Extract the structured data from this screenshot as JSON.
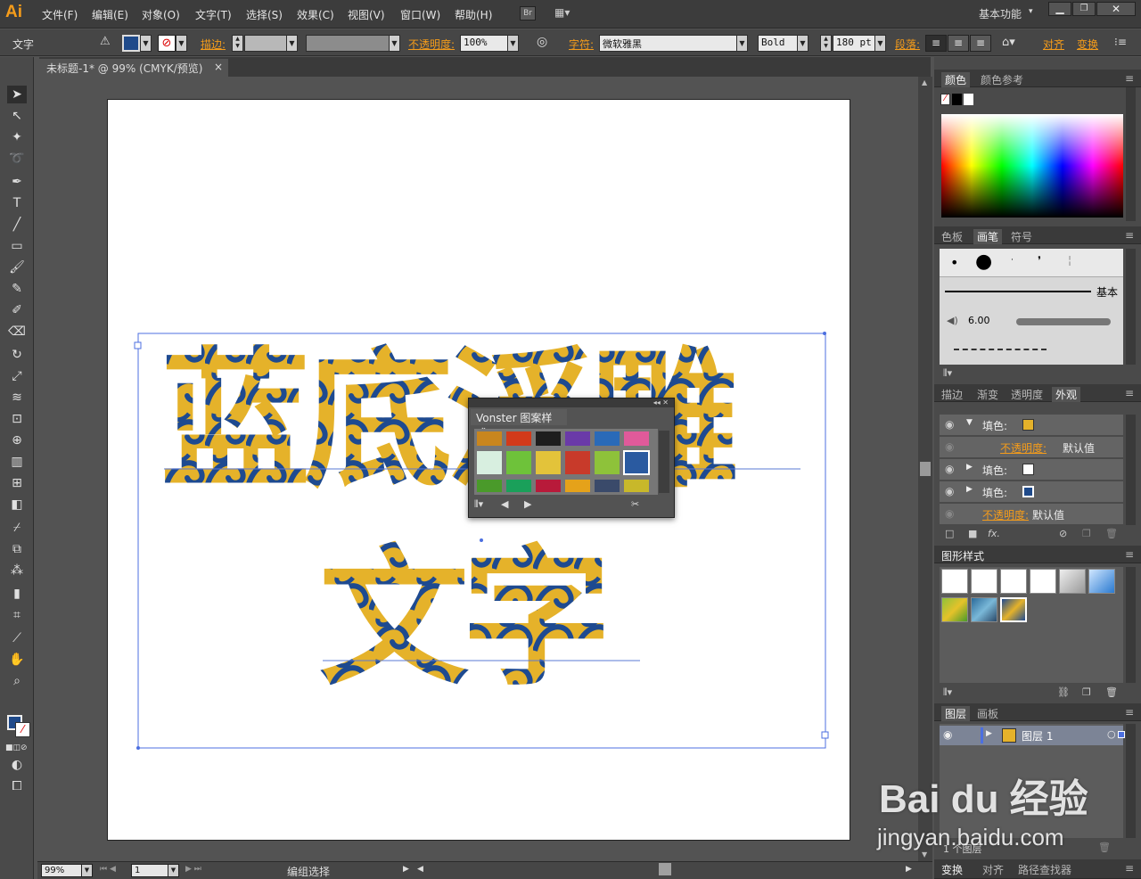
{
  "app": {
    "logo": "Ai",
    "workspace": "基本功能"
  },
  "menus": [
    "文件(F)",
    "编辑(E)",
    "对象(O)",
    "文字(T)",
    "选择(S)",
    "效果(C)",
    "视图(V)",
    "窗口(W)",
    "帮助(H)"
  ],
  "menu_buttons": {
    "bridge": "Br"
  },
  "control": {
    "tool_label": "文字",
    "stroke_label": "描边:",
    "opacity_label": "不透明度:",
    "opacity_value": "100%",
    "char_label": "字符:",
    "font_family": "微软雅黑",
    "font_style": "Bold",
    "font_size": "180 pt",
    "para_label": "段落:",
    "align_label": "对齐",
    "transform_label": "变换"
  },
  "document": {
    "tab_title": "未标题-1* @ 99% (CMYK/预览)",
    "close": "×"
  },
  "artwork": {
    "line1": "蓝底浮雕",
    "line2": "文字",
    "fill_gold": "#e5b22a",
    "fill_blue": "#1e4a90"
  },
  "status": {
    "zoom": "99%",
    "page": "1",
    "info": "编组选择"
  },
  "panels": {
    "color": {
      "tabs": [
        "颜色",
        "颜色参考"
      ]
    },
    "brushes": {
      "tabs": [
        "色板",
        "画笔",
        "符号"
      ],
      "basic_label": "基本",
      "size_value": "6.00"
    },
    "appearance": {
      "tabs": [
        "描边",
        "渐变",
        "透明度",
        "外观"
      ],
      "rows": [
        {
          "label": "填色:",
          "value": ""
        },
        {
          "label": "不透明度:",
          "value": "默认值"
        },
        {
          "label": "填色:",
          "value": ""
        },
        {
          "label": "填色:",
          "value": ""
        },
        {
          "label": "不透明度:",
          "value": "默认值"
        }
      ],
      "fx_label": "fx."
    },
    "graphic_styles": {
      "tabs": [
        "图形样式"
      ]
    },
    "layers": {
      "tabs": [
        "图层",
        "画板"
      ],
      "layer_name": "图层 1",
      "footer": "1 个图层"
    },
    "bottom_tabs": [
      "变换",
      "对齐",
      "路径查找器"
    ]
  },
  "floating_panel": {
    "title": "Vonster 图案样式"
  },
  "watermark": {
    "brand": "Bai du 经验",
    "url": "jingyan.baidu.com"
  }
}
